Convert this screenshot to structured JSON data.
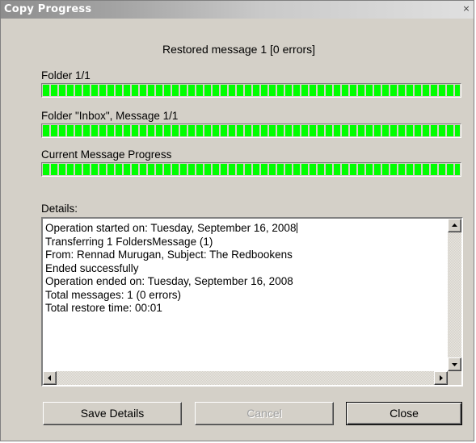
{
  "window": {
    "title": "Copy Progress",
    "close_glyph": "×"
  },
  "status": {
    "headline": "Restored message 1 [0 errors]"
  },
  "progress": {
    "folder": {
      "label": "Folder 1/1",
      "fraction": 1.0
    },
    "message": {
      "label": "Folder \"Inbox\", Message 1/1",
      "fraction": 1.0
    },
    "current": {
      "label": "Current Message Progress",
      "fraction": 1.0
    },
    "fill_color": "#00ff00"
  },
  "details": {
    "label": "Details:",
    "lines": [
      "Operation started on: Tuesday, September 16, 2008",
      "Transferring 1 FoldersMessage (1)",
      "From: Rennad Murugan, Subject: The Redbookens",
      "Ended successfully",
      "Operation ended on: Tuesday, September 16, 2008",
      "Total messages: 1 (0 errors)",
      "Total restore time: 00:01"
    ],
    "scroll_icons": {
      "up": "arrow-up-icon",
      "down": "arrow-down-icon",
      "left": "arrow-left-icon",
      "right": "arrow-right-icon"
    }
  },
  "buttons": {
    "save_details": "Save Details",
    "cancel": "Cancel",
    "close": "Close"
  }
}
